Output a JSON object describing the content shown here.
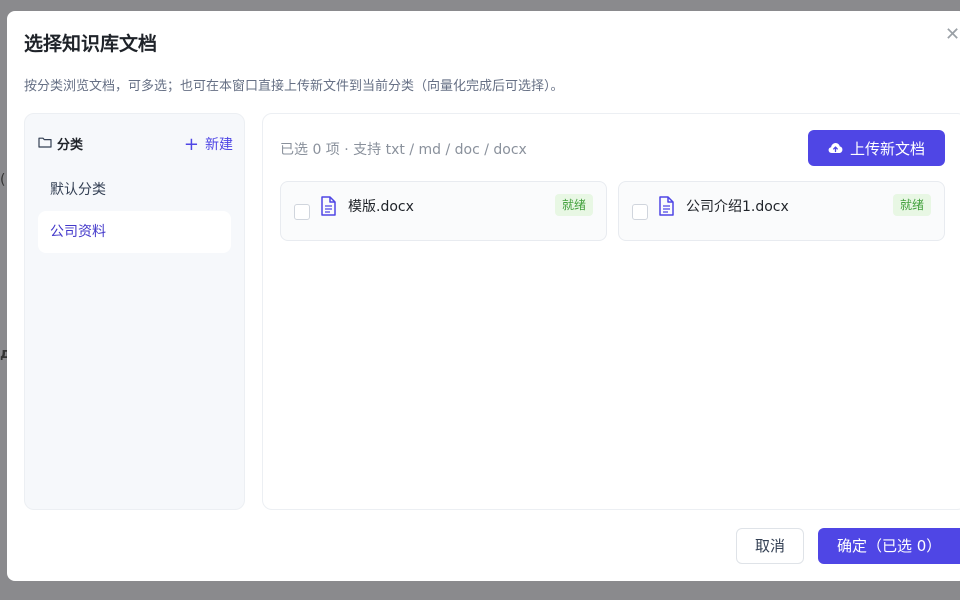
{
  "dialog": {
    "title": "选择知识库文档",
    "description": "按分类浏览文档，可多选；也可在本窗口直接上传新文件到当前分类（向量化完成后可选择）。",
    "close_icon": "close-icon"
  },
  "sidebar": {
    "title": "分类",
    "title_icon": "folder-icon",
    "new_label": "新建",
    "categories": [
      {
        "label": "默认分类",
        "active": false
      },
      {
        "label": "公司资料",
        "active": true
      }
    ]
  },
  "main": {
    "selected_info": "已选 0 项 · 支持 txt / md / doc / docx",
    "upload_label": "上传新文档",
    "upload_icon": "cloud-upload-icon",
    "documents": [
      {
        "name": "模版.docx",
        "status": "就绪",
        "checked": false
      },
      {
        "name": "公司介绍1.docx",
        "status": "就绪",
        "checked": false
      }
    ]
  },
  "footer": {
    "cancel_label": "取消",
    "confirm_label": "确定（已选 0）"
  },
  "colors": {
    "accent": "#4f46e5",
    "ready_badge_bg": "#e8f7e4",
    "ready_badge_text": "#41a03b"
  }
}
